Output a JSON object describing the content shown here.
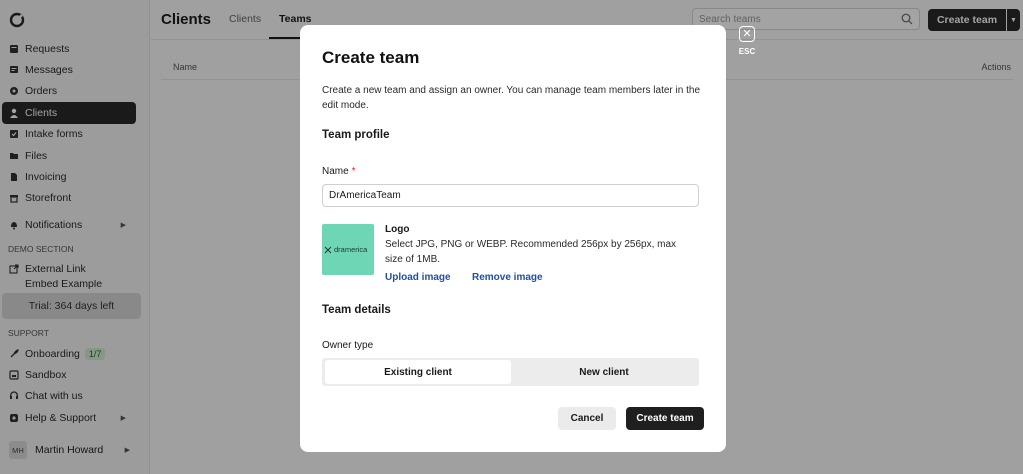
{
  "sidebar": {
    "items": [
      {
        "label": "Requests",
        "icon": "inbox-icon"
      },
      {
        "label": "Messages",
        "icon": "chat-icon"
      },
      {
        "label": "Orders",
        "icon": "gear-icon"
      },
      {
        "label": "Clients",
        "icon": "person-icon"
      },
      {
        "label": "Intake forms",
        "icon": "checkbox-icon"
      },
      {
        "label": "Files",
        "icon": "folder-icon"
      },
      {
        "label": "Invoicing",
        "icon": "document-icon"
      },
      {
        "label": "Storefront",
        "icon": "store-icon"
      },
      {
        "label": "Notifications",
        "icon": "bell-icon"
      }
    ],
    "demo_section_label": "DEMO SECTION",
    "external_link_label": "External Link",
    "embed_example_label": "Embed Example",
    "trial_label": "Trial: 364 days left",
    "support_label": "SUPPORT",
    "onboarding_label": "Onboarding",
    "onboarding_badge": "1/7",
    "sandbox_label": "Sandbox",
    "chat_label": "Chat with us",
    "help_label": "Help & Support",
    "user_initials": "MH",
    "user_name": "Martin Howard"
  },
  "header": {
    "title": "Clients",
    "tabs": [
      "Clients",
      "Teams"
    ],
    "search_placeholder": "Search teams",
    "create_button": "Create team"
  },
  "table": {
    "col_name": "Name",
    "col_actions": "Actions"
  },
  "esc_label": "ESC",
  "modal": {
    "title": "Create team",
    "description": "Create a new team and assign an owner. You can manage team members later in the edit mode.",
    "profile_heading": "Team profile",
    "name_label": "Name",
    "name_required": "*",
    "name_value": "DrAmericaTeam",
    "logo_text": "dramerica",
    "logo_title": "Logo",
    "logo_desc": "Select JPG, PNG or WEBP. Recommended 256px by 256px, max size of 1MB.",
    "upload_link": "Upload image",
    "remove_link": "Remove image",
    "details_heading": "Team details",
    "owner_type_label": "Owner type",
    "owner_options": [
      "Existing client",
      "New client"
    ],
    "selected_owner": "Existing client",
    "cancel_label": "Cancel",
    "create_label": "Create team"
  },
  "colors": {
    "accent_dark": "#1f1f1f",
    "link": "#1f4fa8",
    "logo_bg": "#6fd6b5",
    "required": "#dd2222"
  }
}
